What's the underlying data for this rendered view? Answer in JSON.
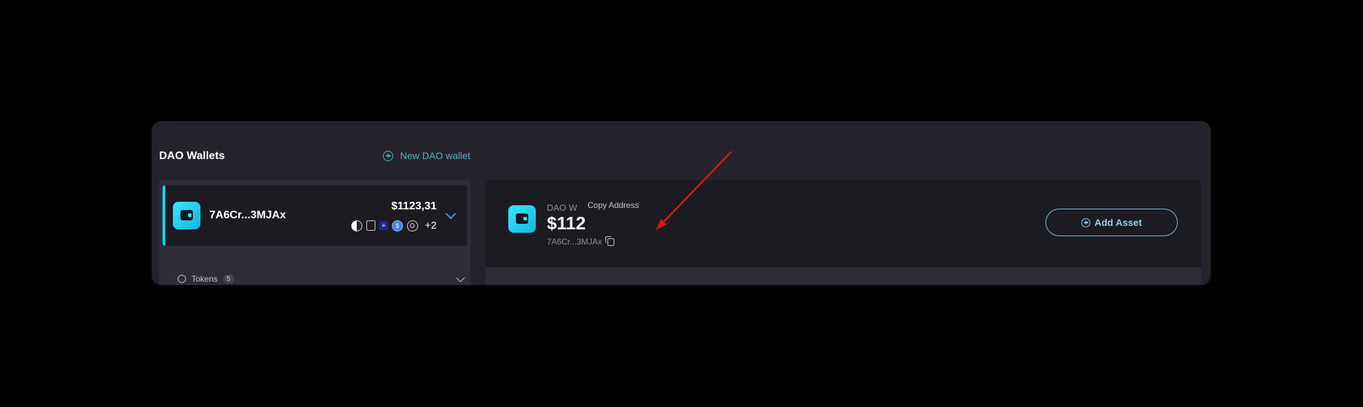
{
  "header": {
    "title": "DAO Wallets",
    "new_wallet_label": "New DAO wallet"
  },
  "wallet_card": {
    "name": "7A6Cr...3MJAx",
    "value": "$1123,31",
    "token_icons": [
      "half-circle-icon",
      "building-icon",
      "stacked-lines-icon",
      "usdc-icon",
      "ring-icon"
    ],
    "more_tokens": "+2"
  },
  "tokens_section": {
    "label": "Tokens",
    "count": "5"
  },
  "main": {
    "dao_label": "DAO W",
    "value": "$112",
    "address": "7A6Cr...3MJAx",
    "tooltip": "Copy Address",
    "add_asset_label": "Add Asset"
  },
  "colors": {
    "accent": "#13d4f2",
    "link": "#4fb8c7",
    "annotation_arrow": "#e0141b"
  }
}
